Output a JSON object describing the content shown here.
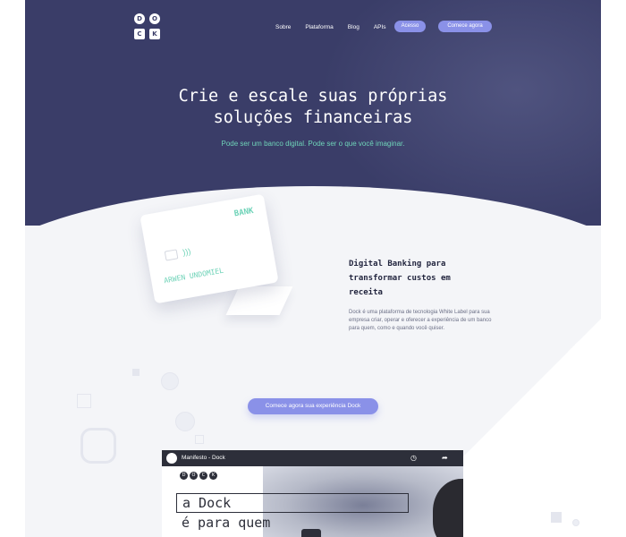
{
  "brand": {
    "letters": [
      "D",
      "O",
      "C",
      "K"
    ]
  },
  "nav": {
    "items": [
      "Sobre",
      "Plataforma",
      "Blog",
      "APIs"
    ],
    "acesso_label": "Acesso",
    "comece_label": "Comece agora"
  },
  "hero": {
    "title_line1": "Crie e escale suas próprias",
    "title_line2": "soluções financeiras",
    "subtitle": "Pode ser um banco digital. Pode ser o que você imaginar."
  },
  "card": {
    "bank_label": "BANK",
    "holder_name": "ARWEN UNDOMIEL"
  },
  "feature": {
    "title": "Digital Banking para transformar custos em receita",
    "body": "Dock é uma plataforma de tecnologia White Label para sua empresa criar, operar e oferecer a experiência de um banco para quem, como e quando você quiser."
  },
  "cta": {
    "label": "Comece agora sua experiência Dock"
  },
  "video": {
    "title": "Manifesto - Dock",
    "logo_letters": [
      "D",
      "O",
      "C",
      "K"
    ],
    "line1": "a Dock",
    "line2": "é para quem"
  },
  "colors": {
    "hero_bg": "#3a3d68",
    "accent": "#8a91e8",
    "mint": "#6fd3b8"
  }
}
